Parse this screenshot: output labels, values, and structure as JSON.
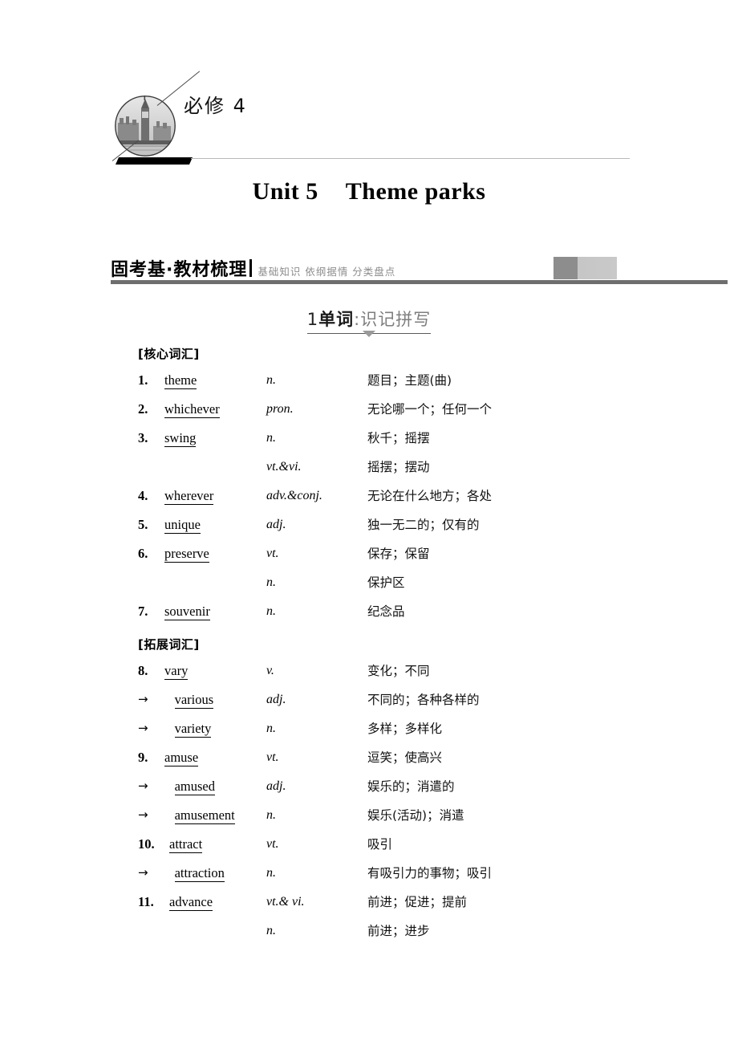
{
  "banner": {
    "label": "必修 4",
    "emblem_icon": "big-ben-photo-icon"
  },
  "unit_title": {
    "unit": "Unit 5",
    "topic": "Theme parks"
  },
  "section_header": {
    "title": "固考基·教材梳理",
    "subtitle": "基础知识 依纲据情 分类盘点"
  },
  "part_heading": {
    "number": "1",
    "strong": "单词",
    "light": ":识记拼写"
  },
  "groups": [
    {
      "label": "[核心词汇]",
      "entries": [
        {
          "num": "1.",
          "word": "theme",
          "derived": false,
          "pos": "n.",
          "def": "题目；主题(曲)"
        },
        {
          "num": "2.",
          "word": "whichever",
          "derived": false,
          "pos": "pron.",
          "def": "无论哪一个；任何一个"
        },
        {
          "num": "3.",
          "word": "swing",
          "derived": false,
          "pos": "n.",
          "def": "秋千；摇摆"
        },
        {
          "num": "",
          "word": "",
          "derived": false,
          "pos": "vt.&vi.",
          "def": "摇摆；摆动"
        },
        {
          "num": "4.",
          "word": "wherever",
          "derived": false,
          "pos": "adv.&conj.",
          "def": "无论在什么地方；各处"
        },
        {
          "num": "5.",
          "word": "unique",
          "derived": false,
          "pos": "adj.",
          "def": "独一无二的；仅有的"
        },
        {
          "num": "6.",
          "word": "preserve",
          "derived": false,
          "pos": "vt.",
          "def": "保存；保留"
        },
        {
          "num": "",
          "word": "",
          "derived": false,
          "pos": "n.",
          "def": "保护区"
        },
        {
          "num": "7.",
          "word": "souvenir",
          "derived": false,
          "pos": "n.",
          "def": "纪念品"
        }
      ]
    },
    {
      "label": "[拓展词汇]",
      "entries": [
        {
          "num": "8.",
          "word": "vary",
          "derived": false,
          "pos": "v.",
          "def": "变化；不同"
        },
        {
          "num": "",
          "word": "various",
          "derived": true,
          "pos": "adj.",
          "def": "不同的；各种各样的"
        },
        {
          "num": "",
          "word": "variety",
          "derived": true,
          "pos": "n.",
          "def": "多样；多样化"
        },
        {
          "num": "9.",
          "word": "amuse",
          "derived": false,
          "pos": "vt.",
          "def": "逗笑；使高兴"
        },
        {
          "num": "",
          "word": "amused",
          "derived": true,
          "pos": "adj.",
          "def": "娱乐的；消遣的"
        },
        {
          "num": "",
          "word": "amusement",
          "derived": true,
          "pos": "n.",
          "def": "娱乐(活动)；消遣"
        },
        {
          "num": "10.",
          "word": "attract",
          "derived": false,
          "pos": "vt.",
          "def": "吸引"
        },
        {
          "num": "",
          "word": "attraction",
          "derived": true,
          "pos": "n.",
          "def": "有吸引力的事物；吸引"
        },
        {
          "num": "11.",
          "word": "advance",
          "derived": false,
          "pos": "vt.& vi.",
          "def": "前进；促进；提前"
        },
        {
          "num": "",
          "word": "",
          "derived": false,
          "pos": "n.",
          "def": "前进；进步"
        }
      ]
    }
  ],
  "colors": {
    "rule_gray": "#6e6e6e",
    "subtitle_gray": "#8d8d8d",
    "badge_dark": "#8d8d8d",
    "badge_light": "#c6c6c6"
  }
}
